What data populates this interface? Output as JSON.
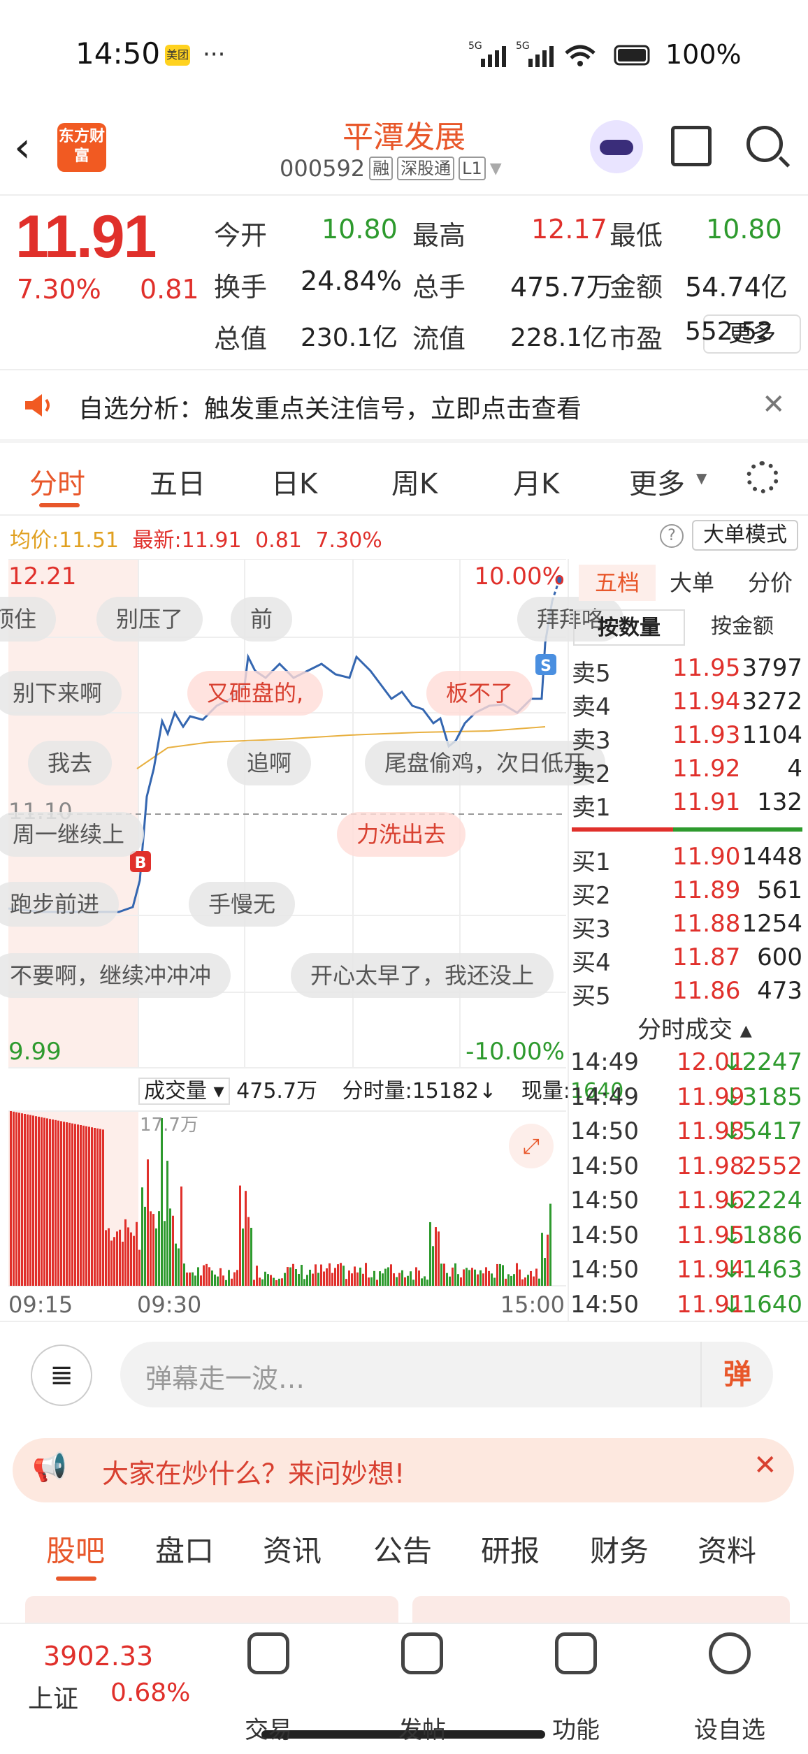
{
  "status": {
    "time": "14:50",
    "app_badge": "美团",
    "dots": "···",
    "battery": "100%"
  },
  "header": {
    "logo": "东方财富",
    "name": "平潭发展",
    "code": "000592",
    "tags": [
      "融",
      "深股通",
      "L1"
    ]
  },
  "quote": {
    "price": "11.91",
    "pct": "7.30%",
    "change": "0.81",
    "rows": [
      [
        {
          "l": "今开",
          "v": "10.80",
          "c": "green"
        },
        {
          "l": "最高",
          "v": "12.17",
          "c": "red"
        },
        {
          "l": "最低",
          "v": "10.80",
          "c": "green"
        }
      ],
      [
        {
          "l": "换手",
          "v": "24.84%",
          "c": "dark"
        },
        {
          "l": "总手",
          "v": "475.7万",
          "c": "dark"
        },
        {
          "l": "金额",
          "v": "54.74亿",
          "c": "dark"
        }
      ],
      [
        {
          "l": "总值",
          "v": "230.1亿",
          "c": "dark"
        },
        {
          "l": "流值",
          "v": "228.1亿",
          "c": "dark"
        },
        {
          "l": "市盈",
          "v": "552.52",
          "c": "dark"
        }
      ]
    ],
    "more": "更多"
  },
  "notice": "自选分析：触发重点关注信号，立即点击查看",
  "tabs": [
    "分时",
    "五日",
    "日K",
    "周K",
    "月K",
    "更多"
  ],
  "avgline": {
    "avg_label": "均价:",
    "avg": "11.51",
    "new_label": "最新:",
    "new": "11.91",
    "chg": "0.81",
    "pct": "7.30%"
  },
  "mode_btn": "大单模式",
  "chart": {
    "top_price": "12.21",
    "top_pct": "10.00%",
    "mid_price": "11.10",
    "bot_price": "9.99",
    "bot_pct": "-10.00%",
    "vol_label": "成交量",
    "vol_total": "475.7万",
    "fen_label": "分时量:15182",
    "now_label": "现量:",
    "now_val": "1640",
    "vol_max": "17.7万",
    "times": [
      "09:15",
      "09:30",
      "15:00"
    ]
  },
  "danmu": [
    "顶住",
    "别压了",
    "前",
    "拜拜咯",
    "别下来啊",
    "又砸盘的,",
    "板不了",
    "我去",
    "追啊",
    "尾盘偷鸡，次日低开",
    "周一继续上",
    "力洗出去",
    "跑步前进",
    "手慢无",
    "不要啊，继续冲冲冲",
    "开心太早了，我还没上"
  ],
  "book": {
    "tabs": [
      "五档",
      "大单",
      "分价"
    ],
    "subtabs": [
      "按数量",
      "按金额"
    ],
    "sell": [
      [
        "卖5",
        "11.95",
        "3797"
      ],
      [
        "卖4",
        "11.94",
        "3272"
      ],
      [
        "卖3",
        "11.93",
        "1104"
      ],
      [
        "卖2",
        "11.92",
        "4"
      ],
      [
        "卖1",
        "11.91",
        "132"
      ]
    ],
    "buy": [
      [
        "买1",
        "11.90",
        "1448"
      ],
      [
        "买2",
        "11.89",
        "561"
      ],
      [
        "买3",
        "11.88",
        "1254"
      ],
      [
        "买4",
        "11.87",
        "600"
      ],
      [
        "买5",
        "11.86",
        "473"
      ]
    ],
    "trades_title": "分时成交",
    "trades": [
      [
        "14:49",
        "12.01",
        "↓2247"
      ],
      [
        "14:49",
        "11.99",
        "↓3185"
      ],
      [
        "14:50",
        "11.98",
        "↓5417"
      ],
      [
        "14:50",
        "11.98",
        "2552"
      ],
      [
        "14:50",
        "11.96",
        "↓2224"
      ],
      [
        "14:50",
        "11.95",
        "↓1886"
      ],
      [
        "14:50",
        "11.94",
        "↓1463"
      ],
      [
        "14:50",
        "11.91",
        "↓1640"
      ]
    ]
  },
  "danmu_input": "弹幕走一波…",
  "danmu_btn": "弹",
  "ad": "大家在炒什么？来问妙想!",
  "bottom_tabs": [
    "股吧",
    "盘口",
    "资讯",
    "公告",
    "研报",
    "财务",
    "资料"
  ],
  "index": {
    "value": "3902.33",
    "name": "上证",
    "pct": "0.68%"
  },
  "nav": [
    "交易",
    "发帖",
    "功能",
    "设自选"
  ]
}
